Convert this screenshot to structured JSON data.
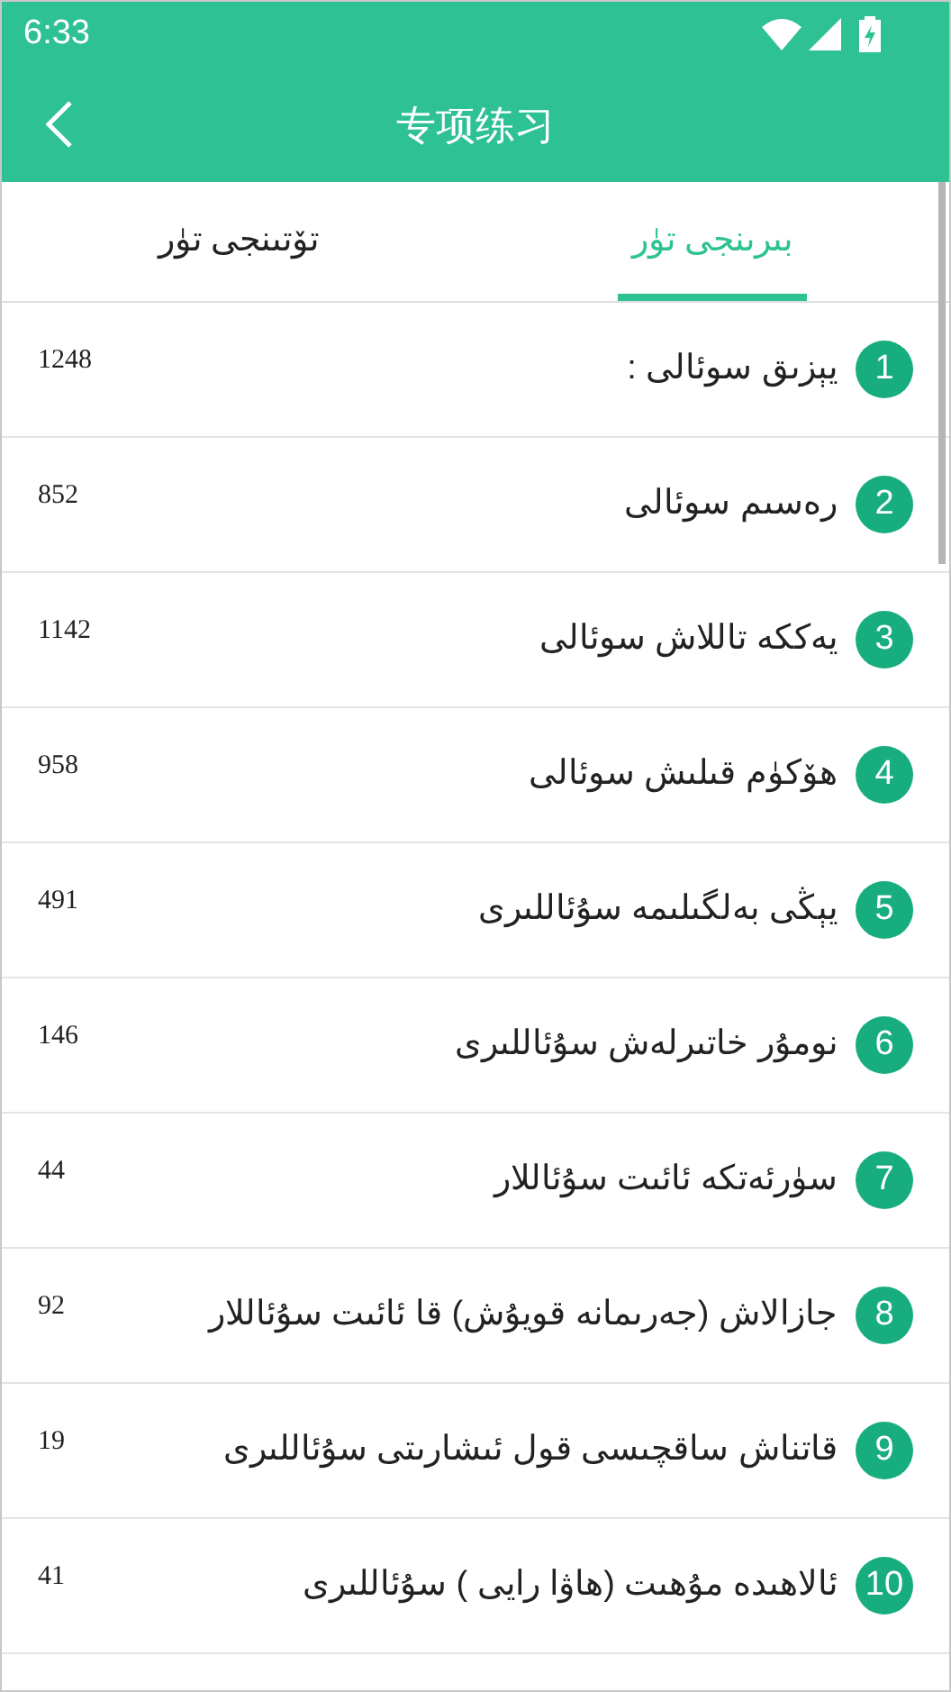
{
  "status_bar": {
    "time": "6:33"
  },
  "app_bar": {
    "title": "专项练习"
  },
  "tabs": [
    {
      "label": "بىرىنجى تۈر",
      "selected": true
    },
    {
      "label": "تۆتىنجى تۈر",
      "selected": false
    }
  ],
  "items": [
    {
      "index": "1",
      "title": "يېزىق سوئالى :",
      "count": "1248"
    },
    {
      "index": "2",
      "title": "رەسىم سوئالى",
      "count": "852"
    },
    {
      "index": "3",
      "title": "يەككە تاللاش سوئالى",
      "count": "1142"
    },
    {
      "index": "4",
      "title": "ھۆكۈم قىلىش سوئالى",
      "count": "958"
    },
    {
      "index": "5",
      "title": "يېڭى بەلگىلىمە سۇئاللىرى",
      "count": "491"
    },
    {
      "index": "6",
      "title": "نومۇر خاتىرلەش سۇئاللىرى",
      "count": "146"
    },
    {
      "index": "7",
      "title": "سۈرئەتكە ئائىت سۇئاللار",
      "count": "44"
    },
    {
      "index": "8",
      "title": "جازالاش (جەرىمانە قويۇش) قا ئائىت سۇئاللار",
      "count": "92"
    },
    {
      "index": "9",
      "title": "قاتناش ساقچىسى قول ئىشارىتى سۇئاللىرى",
      "count": "19"
    },
    {
      "index": "10",
      "title": "ئالاھىدە مۇھىت (ھاۋا رايى ) سۇئاللىرى",
      "count": "41"
    }
  ]
}
